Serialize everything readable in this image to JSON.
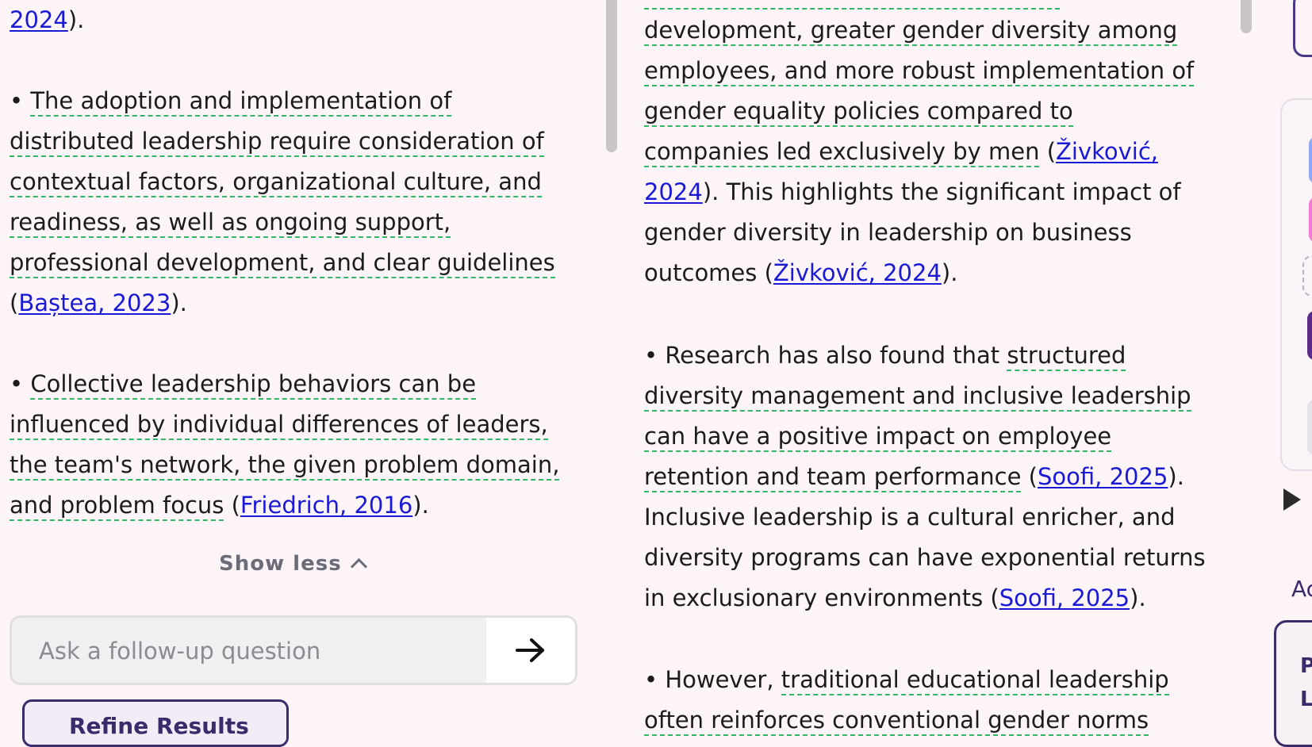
{
  "left": {
    "top_line": {
      "link": "2024",
      "after": ")."
    },
    "bullet1": {
      "lines": [
        [
          "• ",
          "The adoption and implementation of"
        ],
        [
          "",
          "distributed leadership require consideration of"
        ],
        [
          "",
          "contextual factors, organizational culture, and"
        ],
        [
          "",
          "readiness, as well as ongoing support,"
        ],
        [
          "",
          "professional development, and clear guidelines"
        ]
      ],
      "cite_open": "(",
      "cite": "Baștea, 2023",
      "cite_close": ")."
    },
    "bullet2": {
      "lines": [
        [
          "• ",
          "Collective leadership behaviors can be"
        ],
        [
          "",
          "influenced by individual differences of leaders,"
        ],
        [
          "",
          "the team's network, the given problem domain,"
        ]
      ],
      "last_underlined": "and problem focus",
      "cite_open": " (",
      "cite": "Friedrich, 2016",
      "cite_close": ")."
    },
    "show_less": "Show less",
    "followup_placeholder": "Ask a follow-up question",
    "refine_label": "Refine Results"
  },
  "mid": {
    "p1": {
      "u1": "development, greater gender diversity among",
      "u2": "employees, and more robust implementation of",
      "u3": "gender equality policies compared to",
      "u4": "companies led exclusively by men",
      "t4": " (",
      "cite1a": "Živković,",
      "cite1b": "2024",
      "t5": "). This highlights the significant impact of",
      "t6": "gender diversity in leadership on business",
      "t7": "outcomes (",
      "cite2": "Živković, 2024",
      "t7end": ")."
    },
    "p2": {
      "lead": "• Research has also found that ",
      "u1": "structured",
      "u2": "diversity management and inclusive leadership",
      "u3": "can have a positive impact on employee",
      "u4": "retention and team performance",
      "t4": " (",
      "cite1": "Soofi, 2025",
      "t4end": ").",
      "t5": "Inclusive leadership is a cultural enricher, and",
      "t6": "diversity programs can have exponential returns",
      "t7": "in exclusionary environments (",
      "cite2": "Soofi, 2025",
      "t7end": ")."
    },
    "p3": {
      "lead": "• However, ",
      "u1": "traditional educational leadership",
      "u2": "often reinforces conventional gender norms"
    }
  },
  "right": {
    "ac_text": "Ac",
    "p_text": "P",
    "l_text": "L"
  }
}
